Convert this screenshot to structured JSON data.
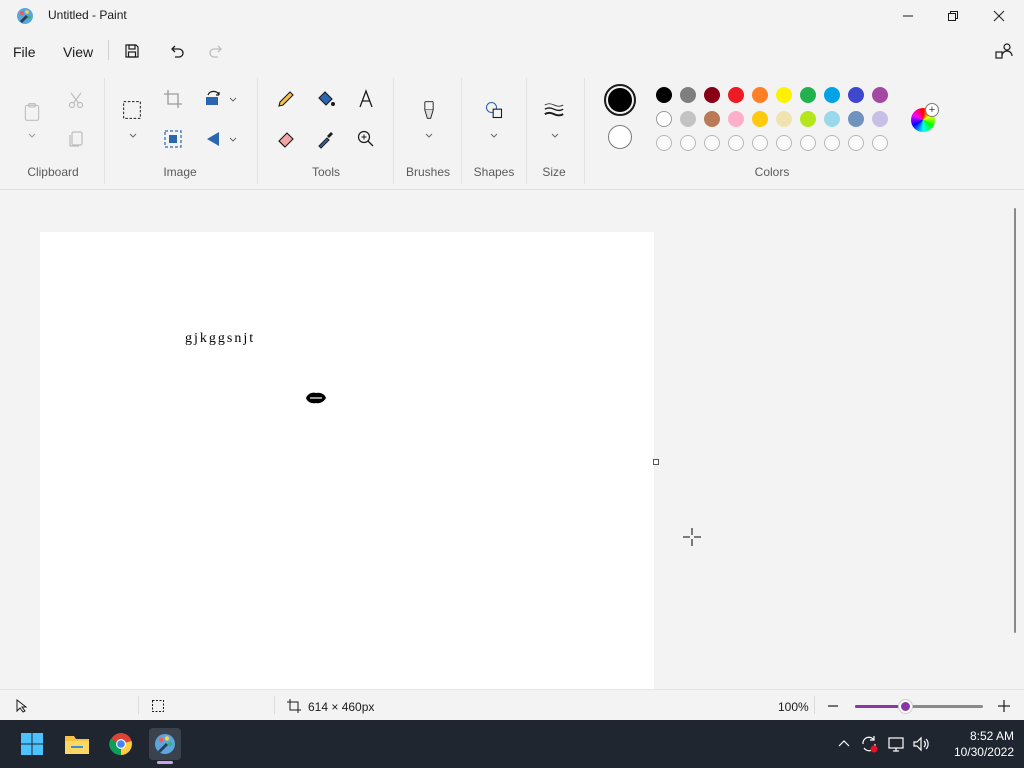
{
  "window": {
    "title": "Untitled - Paint"
  },
  "menu": {
    "file": "File",
    "view": "View"
  },
  "ribbon": {
    "groups": {
      "clipboard": "Clipboard",
      "image": "Image",
      "tools": "Tools",
      "brushes": "Brushes",
      "shapes": "Shapes",
      "size": "Size",
      "colors": "Colors"
    }
  },
  "palette": {
    "primary": "#000000",
    "secondary": "#ffffff",
    "row1": [
      "#000000",
      "#7f7f7f",
      "#880015",
      "#ed1c24",
      "#ff7f27",
      "#fff200",
      "#22b14c",
      "#00a2e8",
      "#3f48cc",
      "#a349a4"
    ],
    "row2": [
      "#ffffff",
      "#c3c3c3",
      "#b97a57",
      "#ffaec9",
      "#ffc90e",
      "#efe4b0",
      "#b5e61d",
      "#99d9ea",
      "#7092be",
      "#c8bfe7"
    ],
    "row3_empty_count": 10
  },
  "canvas": {
    "text": "gjkggsnjt"
  },
  "status": {
    "dimensions": "614 × 460px",
    "zoom": "100%",
    "zoom_level_fraction": 0.39,
    "accent": "#8b36a8"
  },
  "taskbar": {
    "time": "8:52 AM",
    "date": "10/30/2022"
  }
}
